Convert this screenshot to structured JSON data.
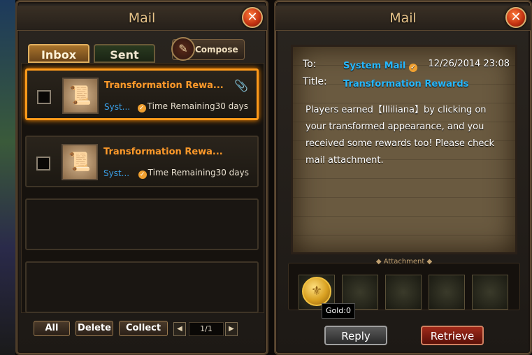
{
  "left_panel": {
    "title": "Mail",
    "tabs": [
      {
        "label": "Inbox",
        "active": true
      },
      {
        "label": "Sent",
        "active": false
      }
    ],
    "compose_label": "Compose",
    "mails": [
      {
        "subject": "Transformation Rewa...",
        "sender": "Syst...",
        "time_label": "Time Remaining",
        "time_value": "30 days",
        "selected": true,
        "has_attachment": true
      },
      {
        "subject": "Transformation Rewa...",
        "sender": "Syst...",
        "time_label": "Time Remaining",
        "time_value": "30 days",
        "selected": false,
        "has_attachment": false
      }
    ],
    "buttons": {
      "all": "All",
      "delete": "Delete",
      "collect": "Collect"
    },
    "pagination": "1/1",
    "close_label": "✕"
  },
  "right_panel": {
    "title": "Mail",
    "to_label": "To:",
    "to_value": "System Mail",
    "date": "12/26/2014 23:08",
    "title_label": "Title:",
    "title_value": "Transformation Rewards",
    "body": "Players earned【Illiliana】by clicking on your transformed appearance, and you received some rewards too! Please check mail attachment.",
    "attachment_label": "Attachment",
    "tooltip": "Gold:0",
    "reply_label": "Reply",
    "retrieve_label": "Retrieve",
    "close_label": "✕"
  },
  "colors": {
    "accent_orange": "#ff9a2a",
    "link_blue": "#28b8ff",
    "selected_border": "#ff9a1a"
  },
  "icons": [
    "close-icon",
    "compose-quill-icon",
    "mail-scroll-icon",
    "verified-icon",
    "paperclip-icon",
    "gold-coin-icon",
    "chevron-left-icon",
    "chevron-right-icon"
  ]
}
